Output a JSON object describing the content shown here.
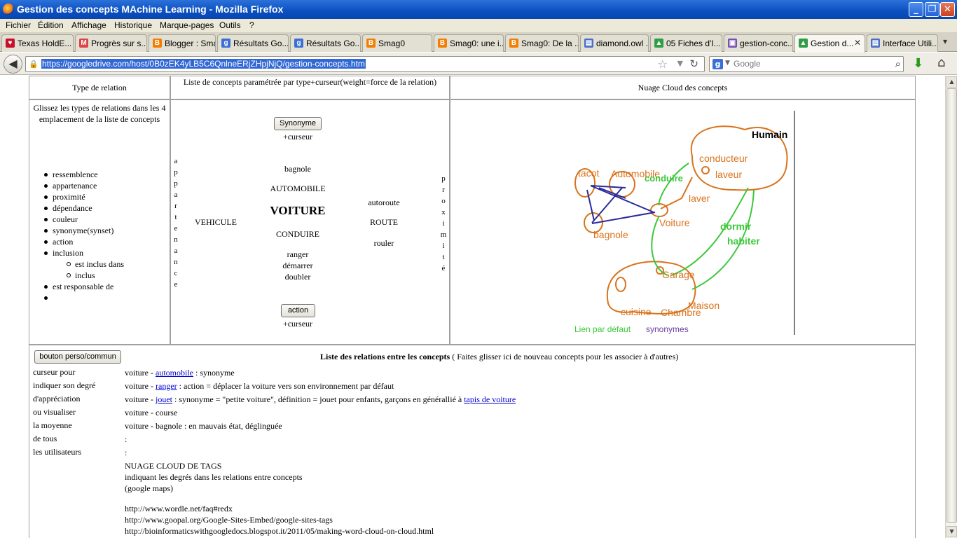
{
  "window": {
    "title": "Gestion des concepts MAchine Learning - Mozilla Firefox",
    "minimize": "_",
    "maximize": "❐",
    "close": "✕"
  },
  "menu": [
    "Fichier",
    "Édition",
    "Affichage",
    "Historique",
    "Marque-pages",
    "Outils",
    "?"
  ],
  "tabs": [
    {
      "label": "Texas HoldE...",
      "icon": "heart-icon",
      "color": "#c8102e",
      "glyph": "♥"
    },
    {
      "label": "Progrès sur s...",
      "icon": "gmail-icon",
      "color": "#d44",
      "glyph": "M"
    },
    {
      "label": "Blogger : Sma...",
      "icon": "blogger-icon",
      "color": "#f57d00",
      "glyph": "B"
    },
    {
      "label": "Résultats Go...",
      "icon": "google-icon",
      "color": "#3b6fd8",
      "glyph": "g"
    },
    {
      "label": "Résultats Go...",
      "icon": "google-icon",
      "color": "#3b6fd8",
      "glyph": "g"
    },
    {
      "label": "Smag0",
      "icon": "blogger-icon",
      "color": "#f57d00",
      "glyph": "B"
    },
    {
      "label": "Smag0: une i...",
      "icon": "blogger-icon",
      "color": "#f57d00",
      "glyph": "B"
    },
    {
      "label": "Smag0: De la ...",
      "icon": "blogger-icon",
      "color": "#f57d00",
      "glyph": "B"
    },
    {
      "label": "diamond.owl ...",
      "icon": "document-icon",
      "color": "#4a6fc9",
      "glyph": "▤"
    },
    {
      "label": "05 Fiches d'I...",
      "icon": "drive-icon",
      "color": "#2f9e44",
      "glyph": "▲"
    },
    {
      "label": "gestion-conc...",
      "icon": "page-icon",
      "color": "#7a4fb3",
      "glyph": "▣"
    },
    {
      "label": "Gestion d...",
      "icon": "drive-icon",
      "color": "#2f9e44",
      "glyph": "▲",
      "active": true
    },
    {
      "label": "Interface Utili...",
      "icon": "document-icon",
      "color": "#4a6fc9",
      "glyph": "▤"
    }
  ],
  "tab_close": "✕",
  "tab_overflow": "▾",
  "nav": {
    "url": "https://googledrive.com/host/0B0zEK4yLB5C6QnlneERjZHpjNjQ/gestion-concepts.htm",
    "search_placeholder": "Google"
  },
  "table": {
    "headers": [
      "Type de relation",
      "Liste de concepts paramétrée par type+curseur(weight=force de la relation)",
      "Nuage Cloud des concepts"
    ],
    "instructions": "Glissez les types de relations dans les 4 emplacement de la liste de concepts",
    "relation_types": [
      {
        "label": "ressemblence",
        "sub": false
      },
      {
        "label": "appartenance",
        "sub": false
      },
      {
        "label": "proximité",
        "sub": false
      },
      {
        "label": "dépendance",
        "sub": false
      },
      {
        "label": "couleur",
        "sub": false
      },
      {
        "label": "synonyme(synset)",
        "sub": false
      },
      {
        "label": "action",
        "sub": false
      },
      {
        "label": "inclusion",
        "sub": false
      },
      {
        "label": "est inclus dans",
        "sub": true
      },
      {
        "label": "inclus",
        "sub": true
      },
      {
        "label": "est responsable de",
        "sub": false
      },
      {
        "label": "",
        "sub": false
      }
    ],
    "concepts": {
      "top_button": "Synonyme",
      "top_cursor": "+curseur",
      "bottom_button": "action",
      "bottom_cursor": "+curseur",
      "left_vertical": [
        "a",
        "p",
        "p",
        "a",
        "r",
        "t",
        "e",
        "n",
        "a",
        "n",
        "c",
        "e"
      ],
      "right_vertical": [
        "p",
        "r",
        "o",
        "x",
        "i",
        "m",
        "i",
        "t",
        "é"
      ],
      "vehicule": "VEHICULE",
      "bagnole": "bagnole",
      "automobile": "AUTOMOBILE",
      "voiture": "VOITURE",
      "conduire": "CONDUIRE",
      "ranger": "ranger",
      "demarrer": "démarrer",
      "doubler": "doubler",
      "autoroute": "autoroute",
      "route": "ROUTE",
      "rouler": "rouler"
    },
    "cloud": {
      "humain": "Humain",
      "conducteur": "conducteur",
      "laveur": "laveur",
      "tacot": "tacot",
      "automobile": "Automobile",
      "conduire": "conduire",
      "laver": "laver",
      "voiture": "Voiture",
      "bagnole": "bagnole",
      "dormir": "dormir",
      "habiter": "habiter",
      "garage": "Garage",
      "cuisine": "cuisine",
      "chambre": "Chambre",
      "maison": "Maison",
      "legend_default": "Lien par défaut",
      "legend_syn": "synonymes",
      "colors": {
        "orange": "#d9731c",
        "green": "#3cc83a",
        "blue": "#2a2a9a",
        "purple": "#6a3fa0"
      }
    }
  },
  "bottom": {
    "button": "bouton perso/commun",
    "title_bold": "Liste des relations entre les concepts",
    "title_rest": " ( Faites glisser ici de nouveau concepts pour les associer à d'autres)",
    "left_lines": [
      "curseur pour",
      "indiquer son degré",
      "d'appréciation",
      "ou visualiser",
      "la moyenne",
      "de tous",
      "les utilisateurs"
    ],
    "relations": [
      {
        "pre": "voiture - ",
        "link": "automobile",
        "post": " : synonyme"
      },
      {
        "pre": "voiture - ",
        "link": "ranger",
        "post": " : action = déplacer la voiture vers son environnement par défaut"
      },
      {
        "pre": "voiture - ",
        "link": "jouet",
        "post": " : synonyme = \"petite voiture\", définition = jouet pour enfants, garçons en générallié à ",
        "link2": "tapis de voiture"
      },
      {
        "pre": "voiture - course"
      },
      {
        "pre": "voiture - bagnole : en mauvais état, déglinguée"
      },
      {
        "pre": ":"
      },
      {
        "pre": ":"
      }
    ],
    "tags_title": "NUAGE CLOUD DE TAGS",
    "tags_line2": "indiquant les degrés dans les relations entre concepts",
    "tags_line3": "(google maps)",
    "links": [
      "http://www.wordle.net/faq#redx",
      "http://www.goopal.org/Google-Sites-Embed/google-sites-tags",
      "http://bioinformaticswithgoogledocs.blogspot.it/2011/05/making-word-cloud-on-cloud.html"
    ]
  }
}
